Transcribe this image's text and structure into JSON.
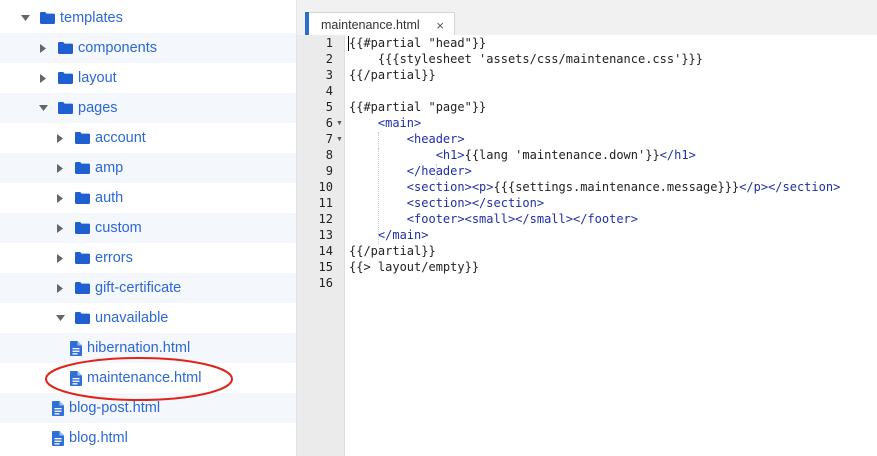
{
  "tree": {
    "items": [
      {
        "label": "templates",
        "type": "folder",
        "expanded": true,
        "depth": 0
      },
      {
        "label": "components",
        "type": "folder",
        "expanded": false,
        "depth": 1
      },
      {
        "label": "layout",
        "type": "folder",
        "expanded": false,
        "depth": 1
      },
      {
        "label": "pages",
        "type": "folder",
        "expanded": true,
        "depth": 1
      },
      {
        "label": "account",
        "type": "folder",
        "expanded": false,
        "depth": 2
      },
      {
        "label": "amp",
        "type": "folder",
        "expanded": false,
        "depth": 2
      },
      {
        "label": "auth",
        "type": "folder",
        "expanded": false,
        "depth": 2
      },
      {
        "label": "custom",
        "type": "folder",
        "expanded": false,
        "depth": 2
      },
      {
        "label": "errors",
        "type": "folder",
        "expanded": false,
        "depth": 2
      },
      {
        "label": "gift-certificate",
        "type": "folder",
        "expanded": false,
        "depth": 2
      },
      {
        "label": "unavailable",
        "type": "folder",
        "expanded": true,
        "depth": 2
      },
      {
        "label": "hibernation.html",
        "type": "file",
        "depth": 3
      },
      {
        "label": "maintenance.html",
        "type": "file",
        "depth": 3,
        "highlighted": true
      },
      {
        "label": "blog-post.html",
        "type": "file",
        "depth": 2
      },
      {
        "label": "blog.html",
        "type": "file",
        "depth": 2
      }
    ]
  },
  "editor": {
    "tab": {
      "label": "maintenance.html",
      "close_label": "×"
    },
    "line_numbers": [
      "1",
      "2",
      "3",
      "4",
      "5",
      "6",
      "7",
      "8",
      "9",
      "10",
      "11",
      "12",
      "13",
      "14",
      "15",
      "16"
    ],
    "folded_lines": [
      6,
      7
    ],
    "lines": [
      "{{#partial \"head\"}}",
      "    {{{stylesheet 'assets/css/maintenance.css'}}}",
      "{{/partial}}",
      "",
      "{{#partial \"page\"}}",
      "    <main>",
      "        <header>",
      "            <h1>{{lang 'maintenance.down'}}</h1>",
      "        </header>",
      "        <section><p>{{{settings.maintenance.message}}}</p></section>",
      "        <section></section>",
      "        <footer><small></small></footer>",
      "    </main>",
      "{{/partial}}",
      "{{> layout/empty}}",
      ""
    ]
  },
  "colors": {
    "accent": "#2b6ecf",
    "tree_text": "#2c68d8",
    "folder_icon": "#1f5fd0",
    "file_icon": "#2f6fd6",
    "tag": "#1f2fa8",
    "annotation": "#e0241b"
  },
  "icons": {
    "folder": "folder-icon",
    "file": "file-icon",
    "collapsed": "caret-right-icon",
    "expanded": "caret-down-icon"
  }
}
